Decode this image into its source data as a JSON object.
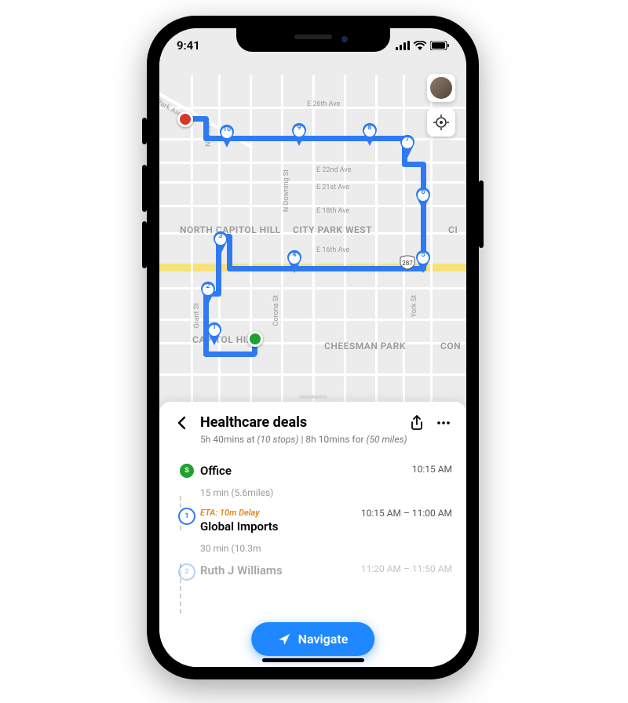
{
  "status": {
    "time": "9:41"
  },
  "map": {
    "areas": {
      "north_capitol_hill": "NORTH CAPITOL HILL",
      "city_park_west": "CITY PARK WEST",
      "capitol_hill": "CAPITOL HILL",
      "cheesman_park": "CHEESMAN PARK",
      "ci": "CI",
      "con": "CON"
    },
    "streets": {
      "e26": "E 26th Ave",
      "e22": "E 22nd Ave",
      "e21": "E 21st Ave",
      "e18": "E 18th Ave",
      "e16": "E 16th Ave",
      "park_w": "Park Ave W",
      "wash": "N Wash",
      "downing": "N Downing St",
      "grant": "Grant St",
      "corona": "Corona St",
      "york": "York St"
    },
    "highway": "287"
  },
  "pins": [
    "1",
    "2",
    "3",
    "4",
    "5",
    "6",
    "7",
    "8",
    "9",
    "10"
  ],
  "sheet": {
    "title": "Healthcare deals",
    "subtitle_a": "5h 40mins at",
    "subtitle_b": "(10 stops)",
    "subtitle_sep": "  |  ",
    "subtitle_c": "8h 10mins for",
    "subtitle_d": "(50 miles)"
  },
  "stops": {
    "start": {
      "marker": "S",
      "name": "Office",
      "time": "10:15 AM"
    },
    "leg1": "15 min (5.6miles)",
    "s1": {
      "marker": "1",
      "eta": "ETA: 10m Delay",
      "name": "Global Imports",
      "time": "10:15 AM – 11:00 AM"
    },
    "leg2": "30 min (10.3m",
    "s2": {
      "marker": "2",
      "name": "Ruth J Williams",
      "time": "11:20 AM – 11:50 AM"
    }
  },
  "navigate": "Navigate"
}
